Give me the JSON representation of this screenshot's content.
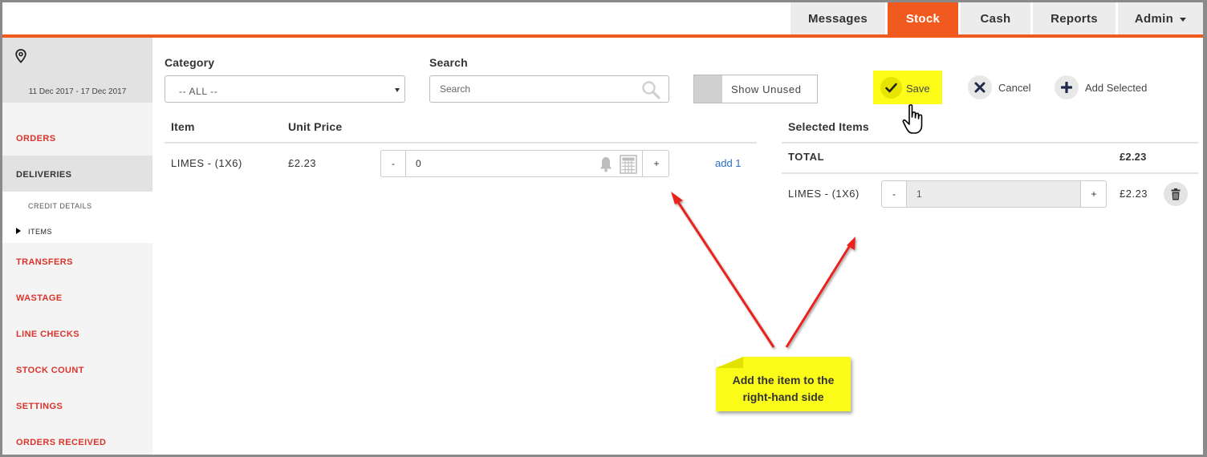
{
  "nav": {
    "tabs": [
      {
        "label": "Messages"
      },
      {
        "label": "Stock"
      },
      {
        "label": "Cash"
      },
      {
        "label": "Reports"
      },
      {
        "label": "Admin"
      }
    ],
    "active_tab": "Stock",
    "accent_color": "#f05a1e"
  },
  "sidebar": {
    "location_icon": "map-pin-icon",
    "date_range": "11 Dec 2017 - 17 Dec 2017",
    "items": [
      {
        "label": "ORDERS"
      },
      {
        "label": "DELIVERIES"
      },
      {
        "label": "TRANSFERS"
      },
      {
        "label": "WASTAGE"
      },
      {
        "label": "LINE CHECKS"
      },
      {
        "label": "STOCK COUNT"
      },
      {
        "label": "SETTINGS"
      },
      {
        "label": "ORDERS RECEIVED"
      }
    ],
    "subitems": [
      {
        "label": "CREDIT DETAILS"
      },
      {
        "label": "ITEMS"
      }
    ],
    "active_item": "DELIVERIES",
    "active_subitem": "ITEMS"
  },
  "filters": {
    "category_label": "Category",
    "category_value": "-- ALL --",
    "search_label": "Search",
    "search_placeholder": "Search",
    "show_unused_label": "Show Unused"
  },
  "actions": {
    "save": "Save",
    "cancel": "Cancel",
    "add_selected": "Add Selected"
  },
  "items_table": {
    "headers": {
      "item": "Item",
      "unit_price": "Unit Price"
    },
    "rows": [
      {
        "item": "LIMES - (1X6)",
        "unit_price": "£2.23",
        "quantity": "0",
        "add_label": "add 1"
      }
    ]
  },
  "selected": {
    "header": "Selected Items",
    "total_label": "TOTAL",
    "total_value": "£2.23",
    "rows": [
      {
        "item": "LIMES - (1X6)",
        "quantity": "1",
        "price": "£2.23"
      }
    ]
  },
  "stepper": {
    "minus": "-",
    "plus": "+"
  },
  "annotation": {
    "line1": "Add the item to the",
    "line2": "right-hand side",
    "color": "#fbfb1a",
    "arrow_color": "#e8231f"
  }
}
